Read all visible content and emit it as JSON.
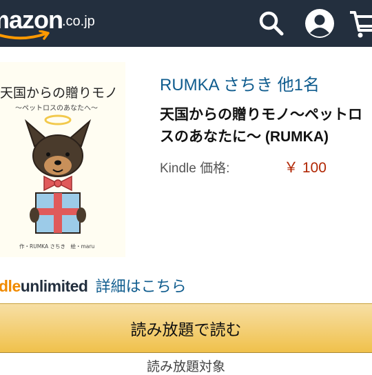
{
  "header": {
    "logo_word": "mazon",
    "logo_tld": ".co.jp",
    "icons": [
      "search-icon",
      "account-icon",
      "cart-icon"
    ],
    "colors": {
      "background": "#232f3e",
      "smile": "#ff9900"
    }
  },
  "product": {
    "author": "RUMKA さちき 他1名",
    "title": "天国からの贈りモノ〜ペットロスのあなたに〜 (RUMKA)",
    "price_label": "Kindle 価格:",
    "price": "￥ 100",
    "cover": {
      "title": "天国からの贈りモノ",
      "subtitle": "〜ペットロスのあなたへ〜",
      "credits": "作・RUMKA さちき　絵・maru"
    }
  },
  "kindle_unlimited": {
    "brand_kindle": "dle",
    "brand_unlimited": "unlimited",
    "details_link": "詳細はこちら"
  },
  "actions": {
    "read_button": "読み放題で読む",
    "eligible_text": "読み放題対象"
  }
}
